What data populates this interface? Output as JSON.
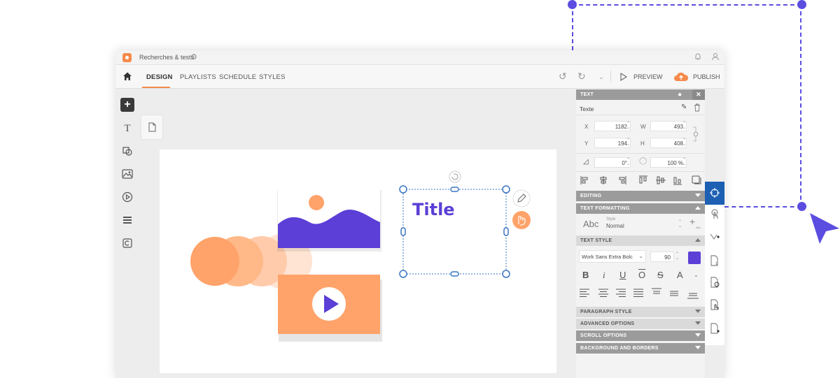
{
  "window": {
    "title": "Recherches & tests"
  },
  "nav": {
    "tabs": [
      "DESIGN",
      "PLAYLISTS",
      "SCHEDULE",
      "STYLES"
    ],
    "active_tab": "DESIGN",
    "preview_label": "PREVIEW",
    "publish_label": "PUBLISH"
  },
  "canvas": {
    "title_text": "Title"
  },
  "panel": {
    "header": "TEXT",
    "element_name": "Texte",
    "x_label": "X",
    "x_value": "1182",
    "y_label": "Y",
    "y_value": "194",
    "w_label": "W",
    "w_value": "493",
    "h_label": "H",
    "h_value": "408",
    "rotation_value": "0°",
    "opacity_value": "100 %",
    "sections": {
      "editing": "EDITING",
      "text_formatting": "TEXT FORMATTING",
      "text_style": "TEXT STYLE",
      "paragraph_style": "PARAGRAPH STYLE",
      "advanced_options": "ADVANCED OPTIONS",
      "scroll_options": "SCROLL OPTIONS",
      "background_borders": "BACKGROUND AND BORDERS"
    },
    "style_preview": "Abc",
    "style_label": "Style",
    "style_value": "Normal",
    "add_style_label": "Abc",
    "font_family": "Work Sans Extra Bolc",
    "font_size": "90",
    "text_color": "#5b3fd6",
    "format_bold": "B",
    "format_italic": "i",
    "format_underline": "U",
    "format_overline": "O",
    "format_strike": "S",
    "format_case": "A"
  },
  "colors": {
    "accent": "#f58a4b",
    "brand_purple": "#5b3fd6",
    "selection": "#1d5fb3",
    "deco": "#5b4de0",
    "illustration_orange": "#ffa36a"
  }
}
